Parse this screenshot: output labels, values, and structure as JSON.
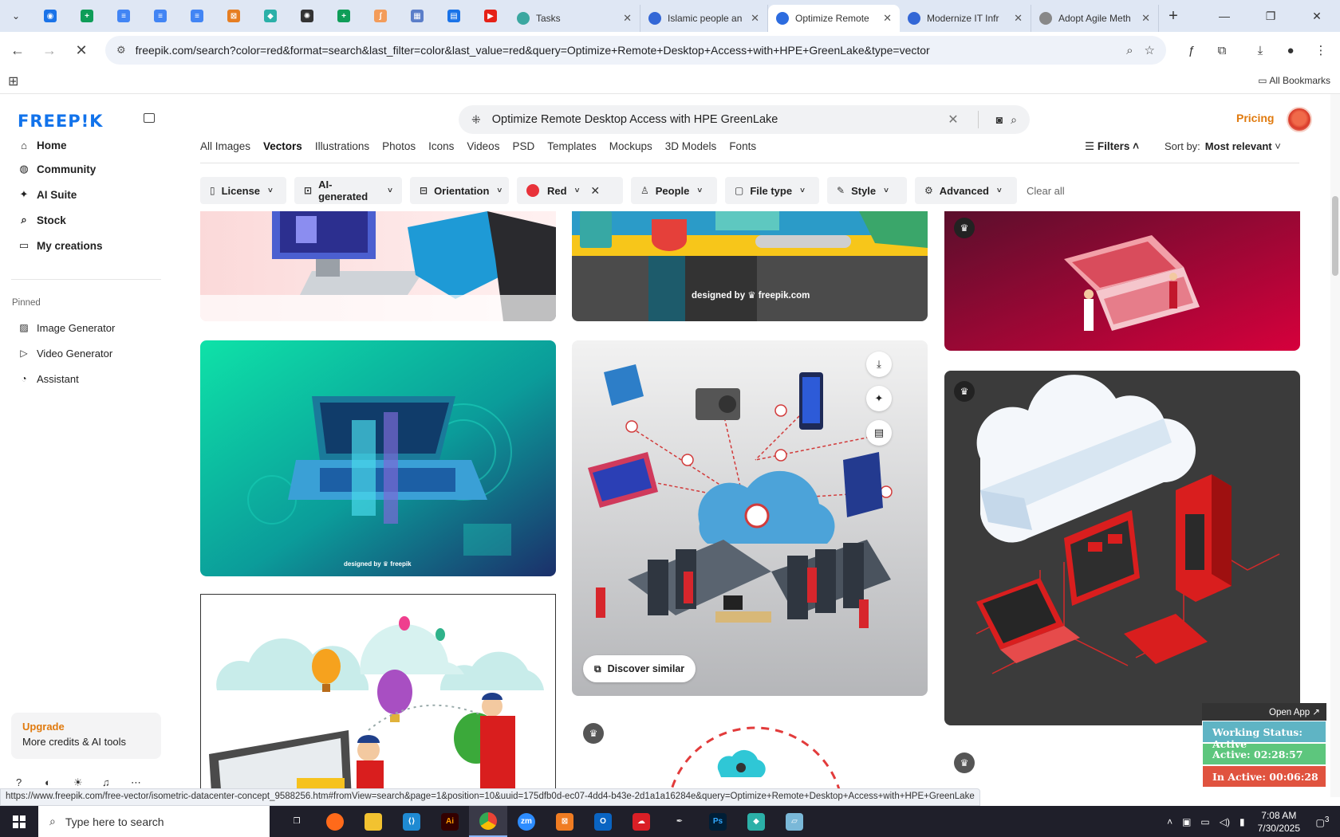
{
  "browser": {
    "tabs": [
      {
        "title": "Tasks",
        "color": "#3ba7a0"
      },
      {
        "title": "Islamic people an",
        "color": "#3367d6"
      },
      {
        "title": "Optimize Remote",
        "color": "#2d6cdf",
        "active": true
      },
      {
        "title": "Modernize IT Infr",
        "color": "#3367d6"
      },
      {
        "title": "Adopt Agile Meth",
        "color": "#888888"
      }
    ],
    "url": "freepik.com/search?color=red&format=search&last_filter=color&last_value=red&query=Optimize+Remote+Desktop+Access+with+HPE+GreenLake&type=vector",
    "all_bookmarks": "All Bookmarks"
  },
  "sidebar": {
    "logo": "FREEP!K",
    "nav": [
      {
        "label": "Home",
        "icon": "home-icon",
        "glyph": "⌂"
      },
      {
        "label": "Community",
        "icon": "globe-icon",
        "glyph": "◍"
      },
      {
        "label": "AI Suite",
        "icon": "sparkle-icon",
        "glyph": "✦"
      },
      {
        "label": "Stock",
        "icon": "search-icon",
        "glyph": "⌕"
      },
      {
        "label": "My creations",
        "icon": "folder-icon",
        "glyph": "▭"
      }
    ],
    "pinned_label": "Pinned",
    "pinned": [
      {
        "label": "Image Generator",
        "icon": "image-icon",
        "glyph": "▨"
      },
      {
        "label": "Video Generator",
        "icon": "video-icon",
        "glyph": "▷"
      },
      {
        "label": "Assistant",
        "icon": "chat-icon",
        "glyph": "◔"
      }
    ],
    "upgrade_title": "Upgrade",
    "upgrade_sub": "More credits & AI tools"
  },
  "header": {
    "search_value": "Optimize Remote Desktop Access with HPE GreenLake",
    "pricing": "Pricing"
  },
  "types": [
    "All Images",
    "Vectors",
    "Illustrations",
    "Photos",
    "Icons",
    "Videos",
    "PSD",
    "Templates",
    "Mockups",
    "3D Models",
    "Fonts"
  ],
  "filters_label": "Filters",
  "sort_label": "Sort by:",
  "sort_value": "Most relevant",
  "chips": {
    "license": "License",
    "ai": "AI-generated",
    "orientation": "Orientation",
    "color": "Red",
    "people": "People",
    "filetype": "File type",
    "style": "Style",
    "advanced": "Advanced",
    "clear": "Clear all"
  },
  "cards": {
    "watermark_top": "designed by ♛ freepik.com",
    "watermark_green": "designed by ♛ freepik",
    "discover": "Discover similar"
  },
  "status_link": "https://www.freepik.com/free-vector/isometric-datacenter-concept_9588256.htm#fromView=search&page=1&position=10&uuid=175dfb0d-ec07-4dd4-b43e-2d1a1a16284e&query=Optimize+Remote+Desktop+Access+with+HPE+GreenLake",
  "tracker": {
    "open_app": "Open App ↗",
    "status": "Working Status: Active",
    "active": "Active: 02:28:57",
    "inactive": "In Active: 00:06:28"
  },
  "taskbar": {
    "search_placeholder": "Type here to search",
    "time": "7:08 AM",
    "date": "7/30/2025",
    "notifications": "3"
  }
}
